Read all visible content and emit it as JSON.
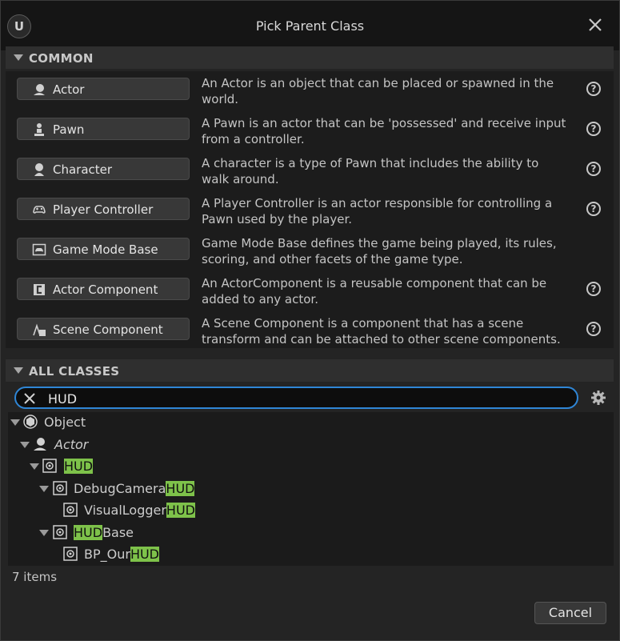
{
  "window": {
    "title": "Pick Parent Class",
    "logo_text": "U",
    "logo_icon": "unreal-logo-icon",
    "close_icon": "close-icon"
  },
  "common": {
    "header": "COMMON",
    "items": [
      {
        "label": "Actor",
        "icon": "actor-icon",
        "desc": "An Actor is an object that can be placed or spawned in the world.",
        "help": true
      },
      {
        "label": "Pawn",
        "icon": "pawn-icon",
        "desc": "A Pawn is an actor that can be 'possessed' and receive input from a controller.",
        "help": true
      },
      {
        "label": "Character",
        "icon": "character-icon",
        "desc": "A character is a type of Pawn that includes the ability to walk around.",
        "help": true
      },
      {
        "label": "Player Controller",
        "icon": "gamepad-icon",
        "desc": "A Player Controller is an actor responsible for controlling a Pawn used by the player.",
        "help": true
      },
      {
        "label": "Game Mode Base",
        "icon": "game-mode-icon",
        "desc": "Game Mode Base defines the game being played, its rules, scoring, and other facets of the game type.",
        "help": false
      },
      {
        "label": "Actor Component",
        "icon": "component-icon",
        "desc": "An ActorComponent is a reusable component that can be added to any actor.",
        "help": true
      },
      {
        "label": "Scene Component",
        "icon": "scene-component-icon",
        "desc": "A Scene Component is a component that has a scene transform and can be attached to other scene components.",
        "help": true
      }
    ],
    "help_glyph": "?"
  },
  "all_classes": {
    "header": "ALL CLASSES",
    "search": {
      "value": "HUD",
      "clear_icon": "clear-search-icon"
    },
    "settings_icon": "gear-icon",
    "tree": [
      {
        "pre": "Object",
        "match": "",
        "post": "",
        "icon": "object-icon"
      },
      {
        "pre": "Actor",
        "match": "",
        "post": "",
        "icon": "actor-icon"
      },
      {
        "pre": "",
        "match": "HUD",
        "post": "",
        "icon": "hud-icon"
      },
      {
        "pre": "DebugCamera",
        "match": "HUD",
        "post": "",
        "icon": "hud-icon"
      },
      {
        "pre": "VisualLogger",
        "match": "HUD",
        "post": "",
        "icon": "hud-icon"
      },
      {
        "pre": "",
        "match": "HUD",
        "post": "Base",
        "icon": "hud-icon"
      },
      {
        "pre": "BP_Our",
        "match": "HUD",
        "post": "",
        "icon": "hud-icon"
      }
    ],
    "count": "7 items"
  },
  "footer": {
    "cancel_label": "Cancel"
  },
  "colors": {
    "search_border": "#2f86d6",
    "match_highlight": "#7ec24a"
  }
}
